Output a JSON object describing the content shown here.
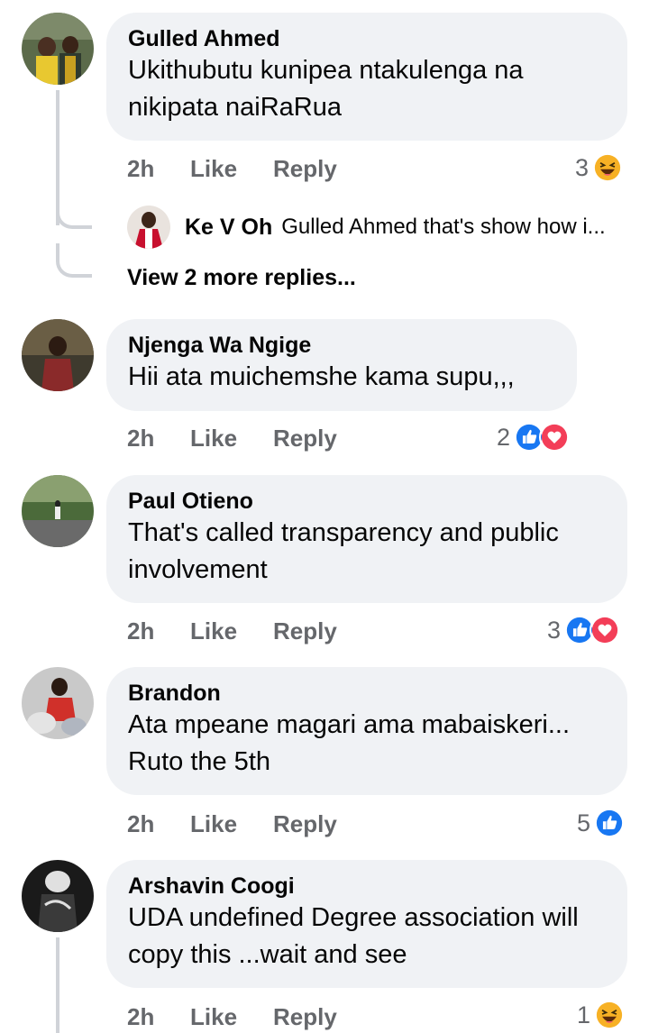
{
  "comments": [
    {
      "author": "Gulled Ahmed",
      "text": "Ukithubutu kunipea ntakulenga na nikipata naiRaRua",
      "time": "2h",
      "like": "Like",
      "reply": "Reply",
      "reaction_count": "3",
      "reactions": [
        "haha-icon"
      ]
    },
    {
      "author": "Njenga Wa Ngige",
      "text": "Hii ata muichemshe kama supu,,,",
      "time": "2h",
      "like": "Like",
      "reply": "Reply",
      "reaction_count": "2",
      "reactions": [
        "like-icon",
        "love-icon"
      ]
    },
    {
      "author": "Paul Otieno",
      "text": "That's called transparency and public involvement",
      "time": "2h",
      "like": "Like",
      "reply": "Reply",
      "reaction_count": "3",
      "reactions": [
        "like-icon",
        "love-icon"
      ]
    },
    {
      "author": "Brandon",
      "text": "Ata mpeane magari ama mabaiskeri... Ruto the 5th",
      "time": "2h",
      "like": "Like",
      "reply": "Reply",
      "reaction_count": "5",
      "reactions": [
        "like-icon"
      ]
    },
    {
      "author": "Arshavin Coogi",
      "text": "UDA undefined Degree association will copy this ...wait and see",
      "time": "2h",
      "like": "Like",
      "reply": "Reply",
      "reaction_count": "1",
      "reactions": [
        "haha-icon"
      ]
    }
  ],
  "reply_preview": {
    "author": "Ke V Oh",
    "text": "Gulled Ahmed that's show how i..."
  },
  "view_more": "View 2 more replies...",
  "colors": {
    "bubble": "#f0f2f5",
    "meta": "#65676b",
    "like_blue": "#1877f2",
    "love_red": "#f33e58",
    "haha_yellow": "#f7b125"
  }
}
